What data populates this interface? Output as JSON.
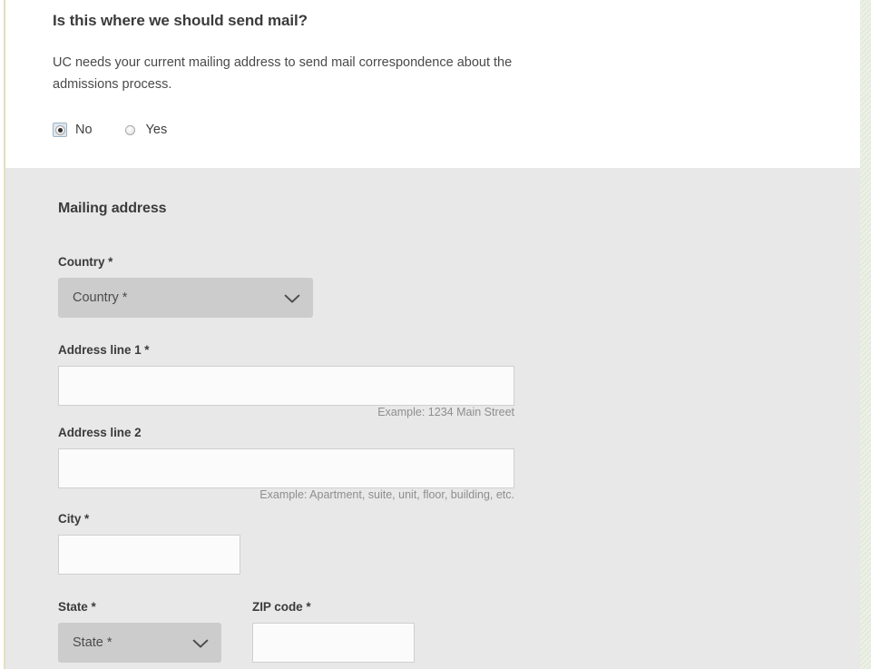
{
  "intro": {
    "title": "Is this where we should send mail?",
    "body": "UC needs your current mailing address to send mail correspondence about the admissions process.",
    "radio_group": {
      "name": "send-mail-here",
      "options": [
        {
          "label": "No",
          "value": "no",
          "selected": true,
          "focused": true
        },
        {
          "label": "Yes",
          "value": "yes",
          "selected": false,
          "focused": false
        }
      ]
    }
  },
  "form": {
    "section_title": "Mailing address",
    "country": {
      "label": "Country *",
      "selected_option": "Country *",
      "icon": "chevron-down-icon"
    },
    "address_line_1": {
      "label": "Address line 1 *",
      "value": "",
      "placeholder": "",
      "hint": "Example: 1234 Main Street"
    },
    "address_line_2": {
      "label": "Address line 2",
      "value": "",
      "placeholder": "",
      "hint": "Example: Apartment, suite, unit, floor, building, etc."
    },
    "city": {
      "label": "City *",
      "value": "",
      "placeholder": ""
    },
    "state": {
      "label": "State *",
      "selected_option": "State *",
      "icon": "chevron-down-icon"
    },
    "zip": {
      "label": "ZIP code *",
      "value": "",
      "placeholder": ""
    }
  },
  "colors": {
    "page_background": "#ffffff",
    "form_section_background": "#e8e8e8",
    "select_background": "#cccccc",
    "input_background": "#fbfbfb",
    "input_border": "#cfcfcf",
    "heading_text": "#3b3b3b",
    "hint_text": "#8e8e8e",
    "left_edge_rule": "#e4dfbe",
    "right_edge_gutter": "#eef1e6",
    "radio_focus_ring": "#9fb4c6"
  }
}
